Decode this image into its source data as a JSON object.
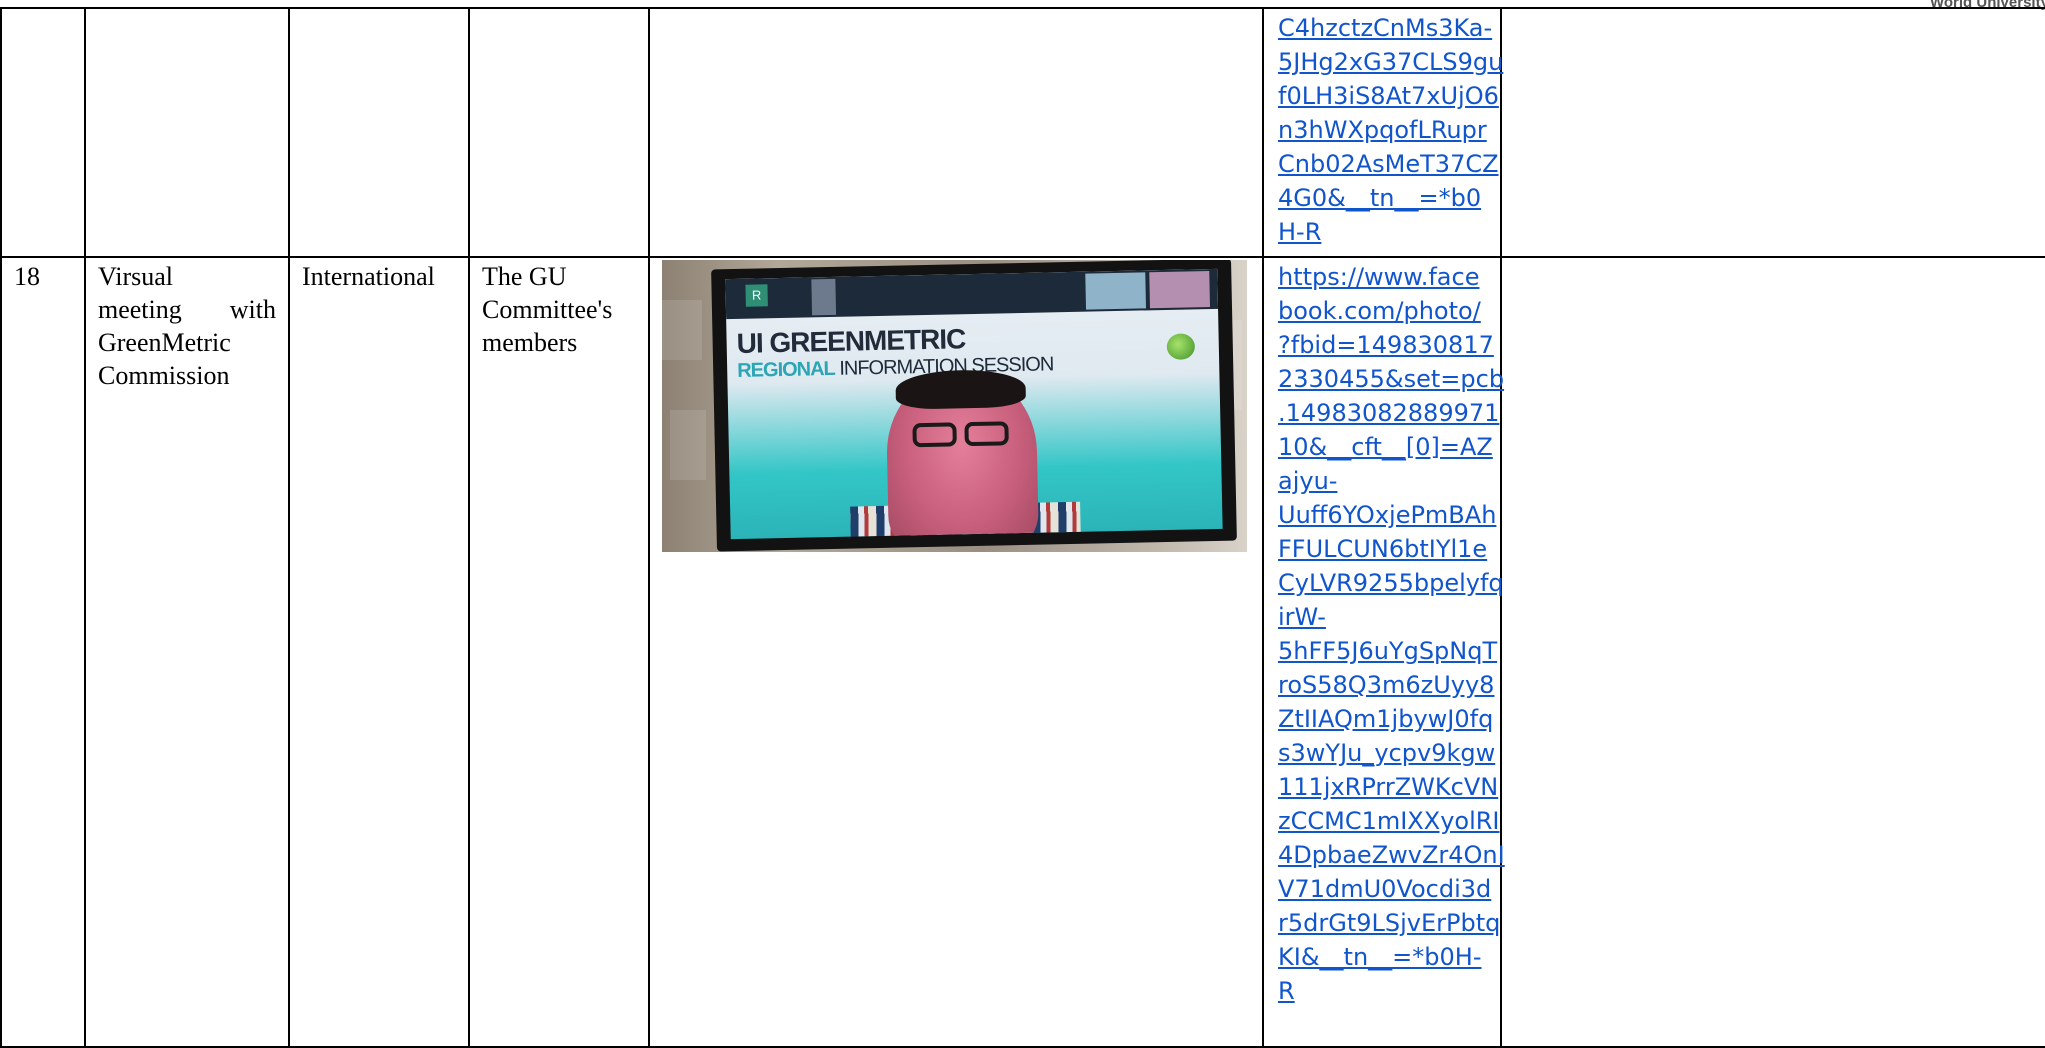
{
  "watermark": "World University R",
  "rows": [
    {
      "no": "",
      "activity": "",
      "scope": "",
      "participants": "",
      "link_lines": [
        "C4hzctzCnMs3Ka-",
        "5JHg2xG37CLS9gu",
        "f0LH3iS8At7xUjO6",
        "n3hWXpqofLRupr",
        "Cnb02AsMeT37CZ",
        "4G0&__tn__=*b0",
        "H-R"
      ],
      "notes": ""
    },
    {
      "no": "18",
      "activity_lines": [
        "Virsual",
        "meeting with",
        "GreenMetric",
        "Commission"
      ],
      "scope": "International",
      "participants_lines": [
        "The GU",
        "Committee's",
        "members"
      ],
      "photo": {
        "screen_title": "UI GREENMETRIC",
        "screen_subtitle_accent": "REGIONAL",
        "screen_subtitle_rest": " INFORMATION SESSION",
        "avatar_letter": "R"
      },
      "link_lines": [
        "https://www.face",
        "book.com/photo/",
        "?fbid=149830817",
        "2330455&set=pcb",
        ".14983082889971",
        "10&__cft__[0]=AZ",
        "ajyu-",
        "Uuff6YOxjePmBAh",
        "FFULCUN6btIYl1e",
        "CyLVR9255bpelyfq",
        "irW-",
        "5hFF5J6uYgSpNqT",
        "roS58Q3m6zUyy8",
        "ZtIIAQm1jbywJ0fq",
        "s3wYJu_ycpv9kgw",
        "111jxRPrrZWKcVN",
        "zCCMC1mIXXyolRI",
        "4DpbaeZwvZr4OnI",
        "V71dmU0Vocdi3d",
        "r5drGt9LSjvErPbtq",
        "KI&__tn__=*b0H-",
        "R"
      ],
      "notes": ""
    }
  ]
}
